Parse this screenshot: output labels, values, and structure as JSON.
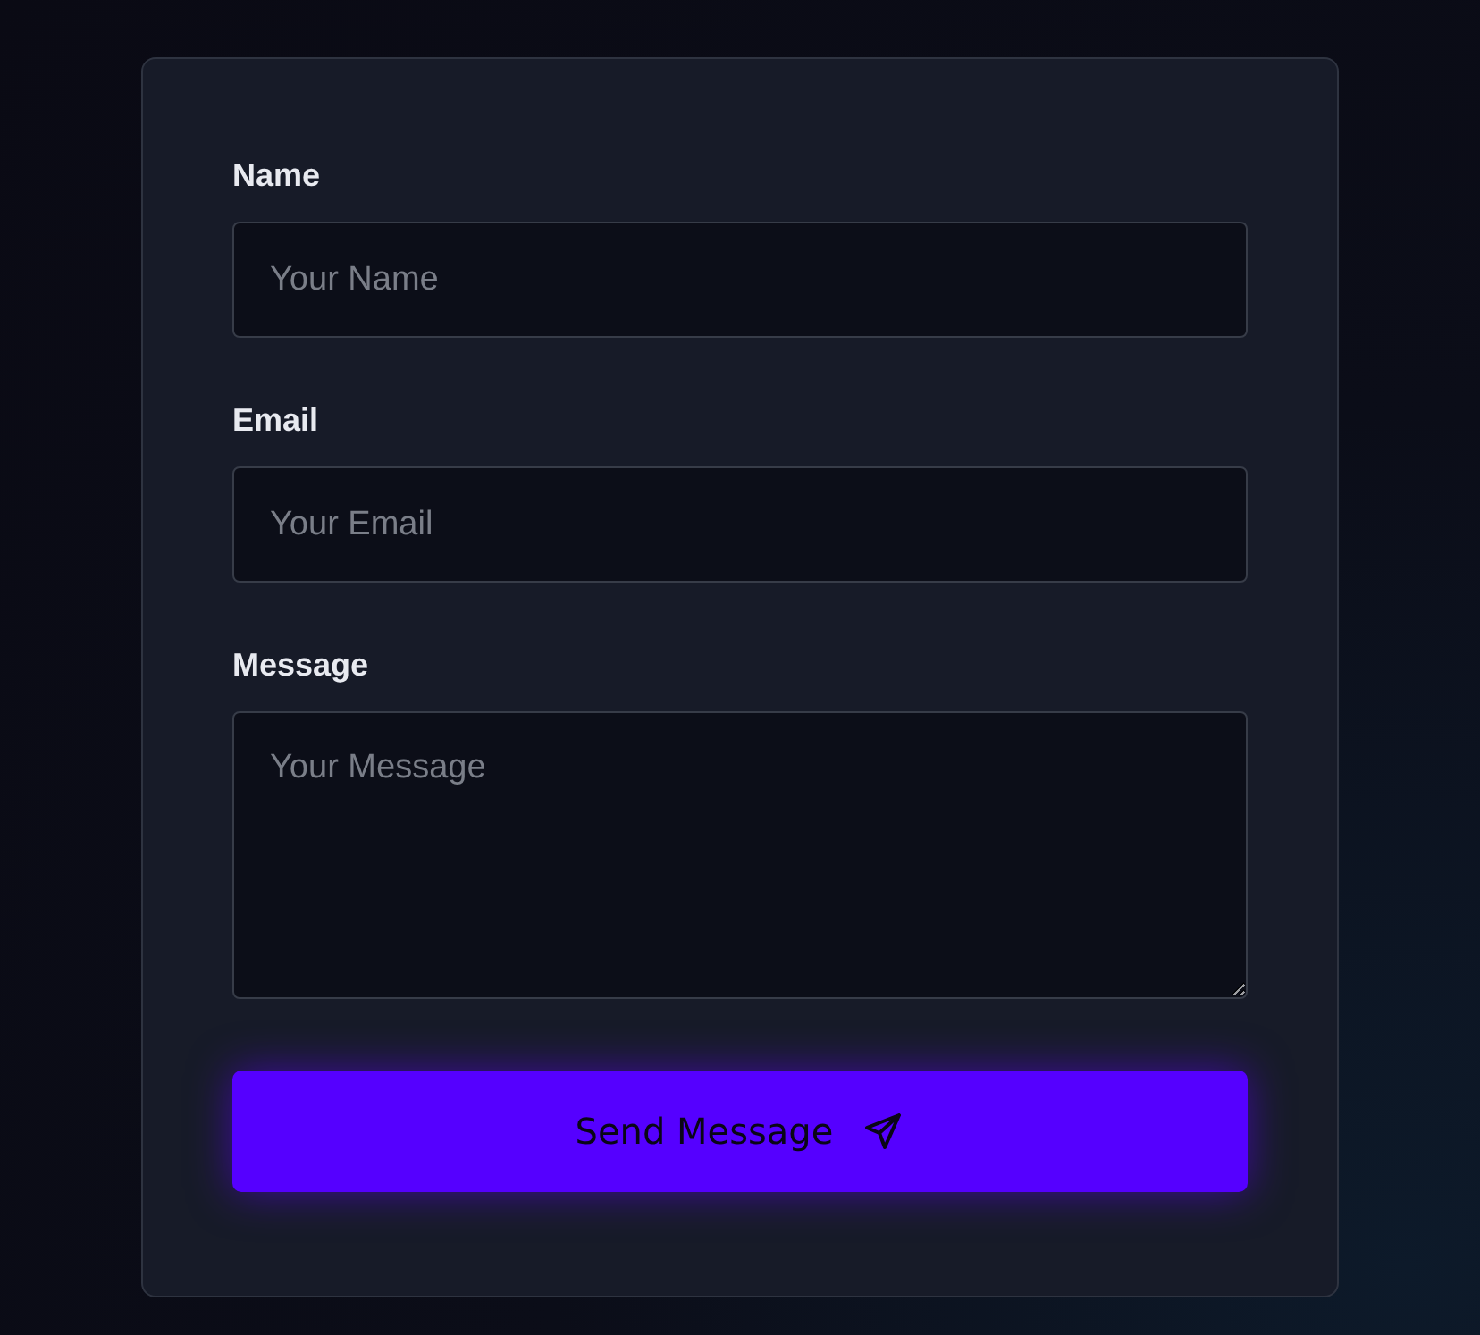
{
  "fields": [
    {
      "label": "Name",
      "kind": "input",
      "placeholder": "Your Name"
    },
    {
      "label": "Email",
      "kind": "input",
      "placeholder": "Your Email"
    },
    {
      "label": "Message",
      "kind": "textarea",
      "placeholder": "Your Message"
    }
  ],
  "submit_button": {
    "label": "Send Message"
  }
}
